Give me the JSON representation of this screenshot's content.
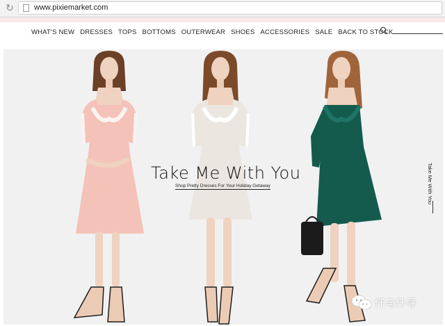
{
  "browser": {
    "url": "www.pixiemarket.com",
    "reload_icon": "reload-icon",
    "page_icon": "page-icon"
  },
  "nav": {
    "items": [
      {
        "label": "WHAT'S NEW"
      },
      {
        "label": "DRESSES"
      },
      {
        "label": "TOPS"
      },
      {
        "label": "BOTTOMS"
      },
      {
        "label": "OUTERWEAR"
      },
      {
        "label": "SHOES"
      },
      {
        "label": "ACCESSORIES"
      },
      {
        "label": "SALE"
      },
      {
        "label": "BACK TO STOCK"
      }
    ],
    "search_icon": "search-icon"
  },
  "hero": {
    "title": "Take Me With You",
    "subtitle": "Shop Pretty Dresses For Your Holiday Getaway",
    "side_label": "Take Me With You",
    "models": [
      {
        "dress": "pink lace-trim pleated cold-shoulder dress",
        "color": "#f4c2b8"
      },
      {
        "dress": "ivory lace-trim pleated cold-shoulder dress",
        "color": "#ece6e0"
      },
      {
        "dress": "teal lace-trim pleated cold-shoulder dress",
        "color": "#145b4e"
      }
    ]
  },
  "watermark": {
    "text": "仟与仟寻",
    "icon": "wechat-icon"
  },
  "colors": {
    "hero_bg": "#f1f1f1",
    "accent_strip": "#f7e9e7",
    "text": "#222222"
  }
}
